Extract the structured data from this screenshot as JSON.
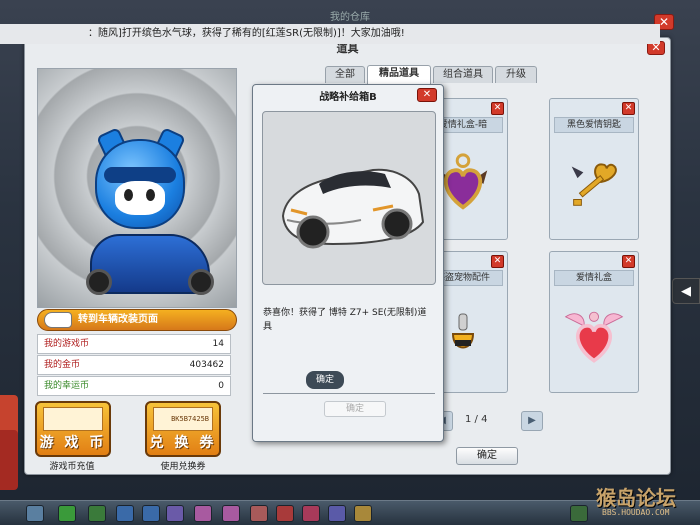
{
  "system_message": "：随风]打开缤色水气球，获得了稀有的[红莲SR(无限制)]！大家加油哦!",
  "window": {
    "title": "道具",
    "close": "✕"
  },
  "top_ghost_title": "我的仓库",
  "character": {
    "goto_label": "转到车辆改装页面"
  },
  "stats": [
    {
      "label": "我的游戏币",
      "value": "14"
    },
    {
      "label": "我的金币",
      "value": "403462"
    },
    {
      "label": "我的幸运币",
      "value": "0"
    }
  ],
  "buttons": {
    "game_coin": {
      "label": "游 戏 币",
      "caption": "游戏币充值"
    },
    "voucher": {
      "label": "兑 换 券",
      "caption": "使用兑换券",
      "code": "BK5B7425B"
    }
  },
  "tabs": [
    "全部",
    "精品道具",
    "组合道具",
    "升级"
  ],
  "active_tab": 1,
  "items": [
    {
      "name": "爱情礼盒-暗",
      "icon": "dark-heart-box-icon"
    },
    {
      "name": "黑色爱情钥匙",
      "icon": "heart-key-icon"
    },
    {
      "name": "海盗宠物配件",
      "icon": "pirate-pet-accessory-icon"
    },
    {
      "name": "爱情礼盒",
      "icon": "winged-heart-box-icon"
    }
  ],
  "pager": {
    "text": "1 / 4",
    "prev": "◀",
    "next": "▶"
  },
  "confirm_label": "确定",
  "popup": {
    "title": "战略补给箱B",
    "message": "恭喜你！获得了 博特 Z7+ SE(无限制)道具",
    "ok_label": "确定",
    "tooltip": "确定"
  },
  "watermark": {
    "main": "猴岛论坛",
    "sub": "BBS.HOUDAO.COM"
  },
  "colors": {
    "accent_orange": "#e27f14",
    "close_red": "#d23a2a",
    "panel_bg": "#e9ecef"
  }
}
